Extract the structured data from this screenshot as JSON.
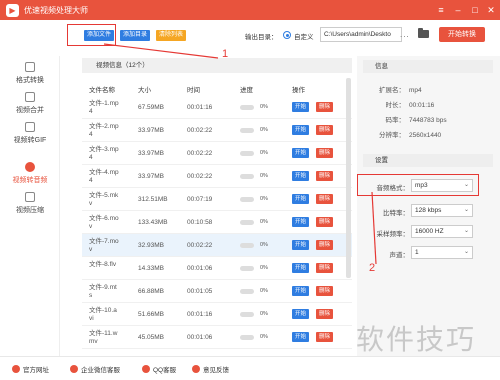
{
  "app": {
    "title": "优速视频处理大师"
  },
  "toolbar": {
    "add_file": "添加文件",
    "add_dir": "添加目录",
    "clear_list": "清除列表",
    "output_label": "输出目录：",
    "custom_label": "自定义",
    "output_path": "C:\\Users\\admin\\Deskto",
    "more": "...",
    "start_convert": "开始转换"
  },
  "sidebar": {
    "items": [
      {
        "label": "格式转换"
      },
      {
        "label": "视频合并"
      },
      {
        "label": "视频转GIF"
      },
      {
        "label": "视频转音频"
      },
      {
        "label": "视频压缩"
      }
    ]
  },
  "list": {
    "header": "视频信息（12个）",
    "columns": [
      "文件名称",
      "大小",
      "时间",
      "进度",
      "操作"
    ],
    "start_label": "开始",
    "delete_label": "删除",
    "rows": [
      {
        "name": "文件-1.mp4",
        "size": "67.59MB",
        "time": "00:01:16",
        "progress": "0%"
      },
      {
        "name": "文件-2.mp4",
        "size": "33.97MB",
        "time": "00:02:22",
        "progress": "0%"
      },
      {
        "name": "文件-3.mp4",
        "size": "33.97MB",
        "time": "00:02:22",
        "progress": "0%"
      },
      {
        "name": "文件-4.mp4",
        "size": "33.97MB",
        "time": "00:02:22",
        "progress": "0%"
      },
      {
        "name": "文件-5.mkv",
        "size": "312.51MB",
        "time": "00:07:19",
        "progress": "0%"
      },
      {
        "name": "文件-6.mov",
        "size": "133.43MB",
        "time": "00:10:58",
        "progress": "0%"
      },
      {
        "name": "文件-7.mov",
        "size": "32.93MB",
        "time": "00:02:22",
        "progress": "0%"
      },
      {
        "name": "文件-8.flv",
        "size": "14.33MB",
        "time": "00:01:06",
        "progress": "0%"
      },
      {
        "name": "文件-9.mts",
        "size": "66.88MB",
        "time": "00:01:05",
        "progress": "0%"
      },
      {
        "name": "文件-10.avi",
        "size": "51.66MB",
        "time": "00:01:16",
        "progress": "0%"
      },
      {
        "name": "文件-11.wmv",
        "size": "45.05MB",
        "time": "00:01:06",
        "progress": "0%"
      }
    ]
  },
  "info": {
    "header": "信息",
    "items": [
      {
        "k": "扩展名：",
        "v": "mp4"
      },
      {
        "k": "时长：",
        "v": "00:01:16"
      },
      {
        "k": "码率：",
        "v": "7448783 bps"
      },
      {
        "k": "分辨率：",
        "v": "2560x1440"
      }
    ]
  },
  "settings": {
    "header": "设置",
    "format_label": "音频格式：",
    "format_value": "mp3",
    "bitrate_label": "比特率：",
    "bitrate_value": "128 kbps",
    "samplerate_label": "采样频率：",
    "samplerate_value": "16000 HZ",
    "channel_label": "声道：",
    "channel_value": "1"
  },
  "annotations": {
    "one": "1",
    "two": "2"
  },
  "footer": {
    "links": [
      "官方网址",
      "企业微信客服",
      "QQ客服",
      "意见反馈"
    ]
  },
  "watermark": "软件技巧",
  "colors": {
    "brand": "#e8533d",
    "primary": "#2f7de1",
    "clear": "#f5a623",
    "annotation": "#e53935"
  }
}
